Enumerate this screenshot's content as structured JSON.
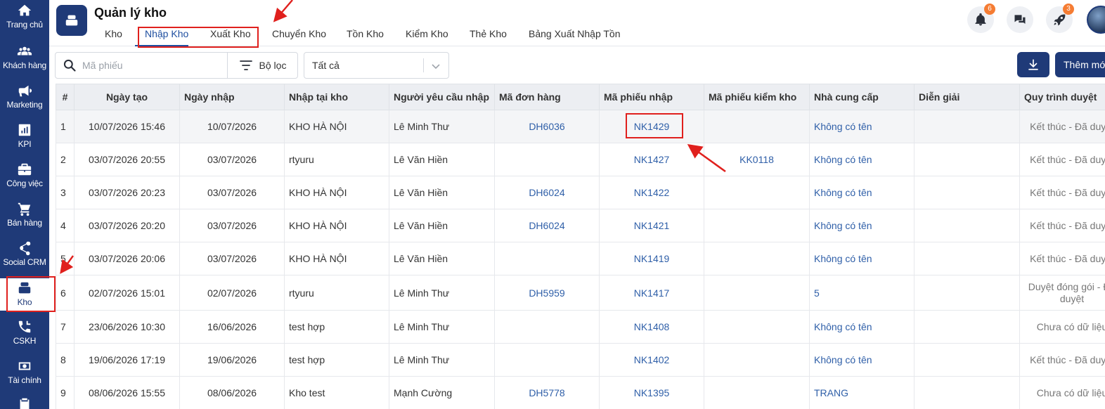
{
  "sidebar": {
    "items": [
      {
        "label": "Trang chủ",
        "icon": "home-icon"
      },
      {
        "label": "Khách hàng",
        "icon": "users-icon"
      },
      {
        "label": "Marketing",
        "icon": "megaphone-icon"
      },
      {
        "label": "KPI",
        "icon": "chart-icon"
      },
      {
        "label": "Công việc",
        "icon": "briefcase-icon"
      },
      {
        "label": "Bán hàng",
        "icon": "cart-icon"
      },
      {
        "label": "Social CRM",
        "icon": "share-icon"
      },
      {
        "label": "Kho",
        "icon": "warehouse-icon",
        "active": true
      },
      {
        "label": "CSKH",
        "icon": "phone-icon"
      },
      {
        "label": "Tài chính",
        "icon": "money-icon"
      }
    ]
  },
  "header": {
    "title": "Quản lý kho",
    "tabs": [
      {
        "label": "Kho"
      },
      {
        "label": "Nhập Kho",
        "active": true
      },
      {
        "label": "Xuất Kho"
      },
      {
        "label": "Chuyển Kho"
      },
      {
        "label": "Tồn Kho"
      },
      {
        "label": "Kiểm Kho"
      },
      {
        "label": "Thẻ Kho"
      },
      {
        "label": "Bảng Xuất Nhập Tồn"
      }
    ],
    "notifications_count": "6",
    "rocket_count": "3"
  },
  "toolbar": {
    "search_placeholder": "Mã phiếu",
    "filter_label": "Bộ lọc",
    "status_select": "Tất cả",
    "add_label": "Thêm mới"
  },
  "table": {
    "headers": [
      "#",
      "Ngày tạo",
      "Ngày nhập",
      "Nhập tại kho",
      "Người yêu cầu nhập",
      "Mã đơn hàng",
      "Mã phiếu nhập",
      "Mã phiếu kiểm kho",
      "Nhà cung cấp",
      "Diễn giải",
      "Quy trình duyệt"
    ],
    "rows": [
      {
        "no": "1",
        "created": "10/07/2026 15:46",
        "import_date": "10/07/2026",
        "warehouse": "KHO HÀ NỘI",
        "requester": "Lê Minh Thư",
        "order": "DH6036",
        "receipt": "NK1429",
        "check": "",
        "supplier": "Không có tên",
        "note": "",
        "process": "Kết thúc - Đã duyệt"
      },
      {
        "no": "2",
        "created": "03/07/2026 20:55",
        "import_date": "03/07/2026",
        "warehouse": "rtyuru",
        "requester": "Lê Văn Hiền",
        "order": "",
        "receipt": "NK1427",
        "check": "KK0118",
        "supplier": "Không có tên",
        "note": "",
        "process": "Kết thúc - Đã duyệt"
      },
      {
        "no": "3",
        "created": "03/07/2026 20:23",
        "import_date": "03/07/2026",
        "warehouse": "KHO HÀ NỘI",
        "requester": "Lê Văn Hiền",
        "order": "DH6024",
        "receipt": "NK1422",
        "check": "",
        "supplier": "Không có tên",
        "note": "",
        "process": "Kết thúc - Đã duyệt"
      },
      {
        "no": "4",
        "created": "03/07/2026 20:20",
        "import_date": "03/07/2026",
        "warehouse": "KHO HÀ NỘI",
        "requester": "Lê Văn Hiền",
        "order": "DH6024",
        "receipt": "NK1421",
        "check": "",
        "supplier": "Không có tên",
        "note": "",
        "process": "Kết thúc - Đã duyệt"
      },
      {
        "no": "5",
        "created": "03/07/2026 20:06",
        "import_date": "03/07/2026",
        "warehouse": "KHO HÀ NỘI",
        "requester": "Lê Văn Hiền",
        "order": "",
        "receipt": "NK1419",
        "check": "",
        "supplier": "Không có tên",
        "note": "",
        "process": "Kết thúc - Đã duyệt"
      },
      {
        "no": "6",
        "created": "02/07/2026 15:01",
        "import_date": "02/07/2026",
        "warehouse": "rtyuru",
        "requester": "Lê Minh Thư",
        "order": "DH5959",
        "receipt": "NK1417",
        "check": "",
        "supplier": "5",
        "note": "",
        "process": "Duyệt đóng gói - Đã duyệt"
      },
      {
        "no": "7",
        "created": "23/06/2026 10:30",
        "import_date": "16/06/2026",
        "warehouse": "test hợp",
        "requester": "Lê Minh Thư",
        "order": "",
        "receipt": "NK1408",
        "check": "",
        "supplier": "Không có tên",
        "note": "",
        "process": "Chưa có dữ liệu"
      },
      {
        "no": "8",
        "created": "19/06/2026 17:19",
        "import_date": "19/06/2026",
        "warehouse": "test hợp",
        "requester": "Lê Minh Thư",
        "order": "",
        "receipt": "NK1402",
        "check": "",
        "supplier": "Không có tên",
        "note": "",
        "process": "Kết thúc - Đã duyệt"
      },
      {
        "no": "9",
        "created": "08/06/2026 15:55",
        "import_date": "08/06/2026",
        "warehouse": "Kho test",
        "requester": "Mạnh Cường",
        "order": "DH5778",
        "receipt": "NK1395",
        "check": "",
        "supplier": "TRANG",
        "note": "",
        "process": "Chưa có dữ liệu"
      }
    ]
  },
  "colors": {
    "primary": "#1f3a78",
    "link": "#2f5fa8",
    "annotation": "#e0201d",
    "badge": "#f57c33"
  }
}
